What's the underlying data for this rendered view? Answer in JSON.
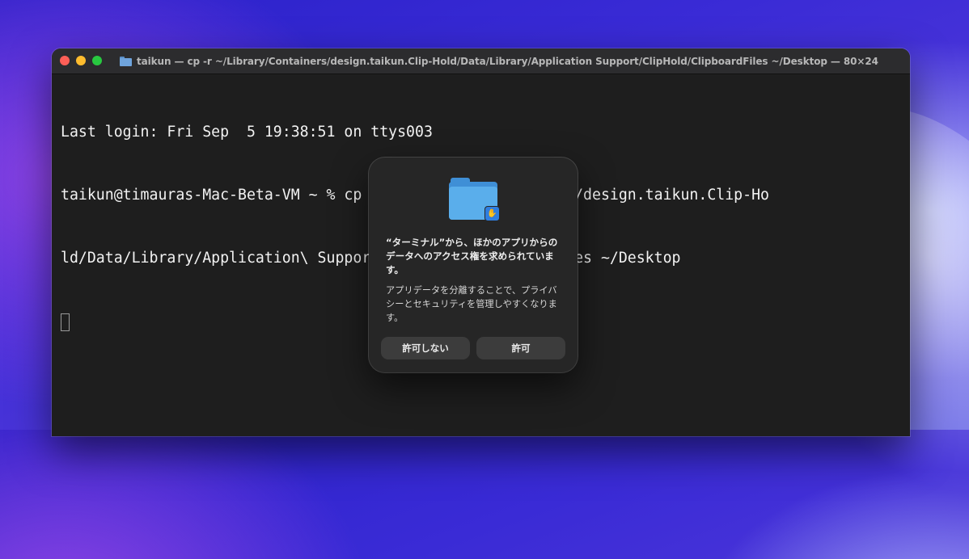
{
  "window": {
    "title": "taikun — cp -r ~/Library/Containers/design.taikun.Clip-Hold/Data/Library/Application Support/ClipHold/ClipboardFiles ~/Desktop — 80×24",
    "title_icon": "folder-icon"
  },
  "terminal": {
    "lines": [
      "Last login: Fri Sep  5 19:38:51 on ttys003",
      "taikun@timauras-Mac-Beta-VM ~ % cp -r ~/Library/Containers/design.taikun.Clip-Ho",
      "ld/Data/Library/Application\\ Support/ClipHold/ClipboardFiles ~/Desktop"
    ]
  },
  "dialog": {
    "icon": "folder-icon",
    "badge_icon": "hand-icon",
    "badge_glyph": "✋",
    "title": "“ターミナル”から、ほかのアプリからのデータへのアクセス権を求められています。",
    "body": "アプリデータを分離することで、プライバシーとセキュリティを管理しやすくなります。",
    "deny_label": "許可しない",
    "allow_label": "許可"
  },
  "colors": {
    "close": "#fe5f57",
    "minimize": "#febc2e",
    "zoom": "#28c840",
    "terminal_bg": "#1e1e1e",
    "folder_blue": "#5aaeeb"
  }
}
